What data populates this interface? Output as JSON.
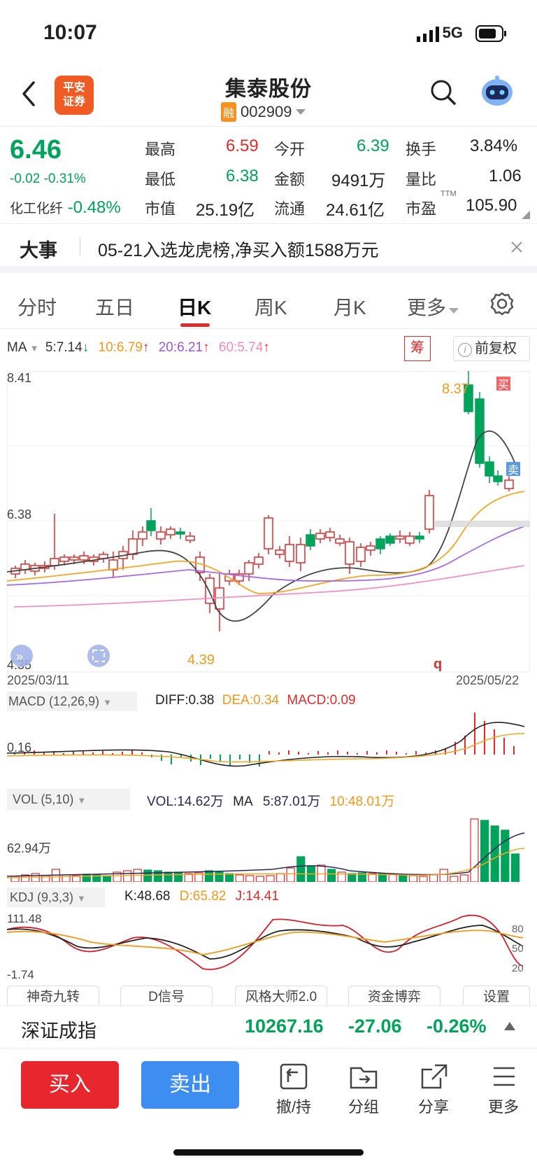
{
  "status": {
    "time": "10:07",
    "network": "5G"
  },
  "header": {
    "title": "集泰股份",
    "code": "002909",
    "margin_badge": "融",
    "broker_logo": "平安\n证券"
  },
  "quote": {
    "price": "6.46",
    "change": "-0.02 -0.31%",
    "sector_name": "化工化纤",
    "sector_change": "-0.48%",
    "high_label": "最高",
    "high": "6.59",
    "low_label": "最低",
    "low": "6.38",
    "cap_label": "市值",
    "cap": "25.19亿",
    "open_label": "今开",
    "open": "6.39",
    "amount_label": "金额",
    "amount": "9491万",
    "float_label": "流通",
    "float": "24.61亿",
    "turnover_label": "换手",
    "turnover": "3.84%",
    "volratio_label": "量比",
    "volratio": "1.06",
    "pe_label": "市盈",
    "pe_sup": "TTM",
    "pe": "105.90"
  },
  "news": {
    "tag": "大事",
    "text": "05-21入选龙虎榜,净买入额1588万元"
  },
  "tabs": [
    "分时",
    "五日",
    "日K",
    "周K",
    "月K",
    "更多"
  ],
  "ma_bar": {
    "ma": "MA",
    "ma5": "5:7.14",
    "ma10": "10:6.79",
    "ma20": "20:6.21",
    "ma60": "60:5.74",
    "chip": "筹",
    "fq": "前复权"
  },
  "kline": {
    "ymax": "8.41",
    "ymid": "6.38",
    "ymin": "4.35",
    "hi_mark": "8.37",
    "lo_mark": "4.39",
    "date_start": "2025/03/11",
    "date_end": "2025/05/22",
    "buy": "买",
    "sell": "卖",
    "q": "q"
  },
  "macd": {
    "label": "MACD (12,26,9)",
    "diff": "DIFF:0.38",
    "dea": "DEA:0.34",
    "macd": "MACD:0.09",
    "axis": "0.16"
  },
  "vol": {
    "label": "VOL (5,10)",
    "vol": "VOL:14.62万",
    "ma": "MA",
    "ma5": "5:87.01万",
    "ma10": "10:48.01万",
    "axis": "62.94万"
  },
  "kdj": {
    "label": "KDJ (9,3,3)",
    "k": "K:48.68",
    "d": "D:65.82",
    "j": "J:14.41",
    "ymax": "111.48",
    "ymin": "-1.74",
    "l80": "80",
    "l50": "50",
    "l20": "20"
  },
  "buttons": [
    "神奇九转",
    "D信号",
    "风格大师2.0",
    "资金博弈",
    "设置"
  ],
  "index": {
    "name": "深证成指",
    "value": "10267.16",
    "change": "-27.06",
    "pct": "-0.26%"
  },
  "bottom": {
    "buy": "买入",
    "sell": "卖出",
    "tools": [
      "撤/持",
      "分组",
      "分享",
      "更多"
    ]
  },
  "colors": {
    "up": "#e02b2b",
    "down": "#00a35a",
    "buy_btn": "#e8262d",
    "sell_btn": "#3d8ef0"
  }
}
